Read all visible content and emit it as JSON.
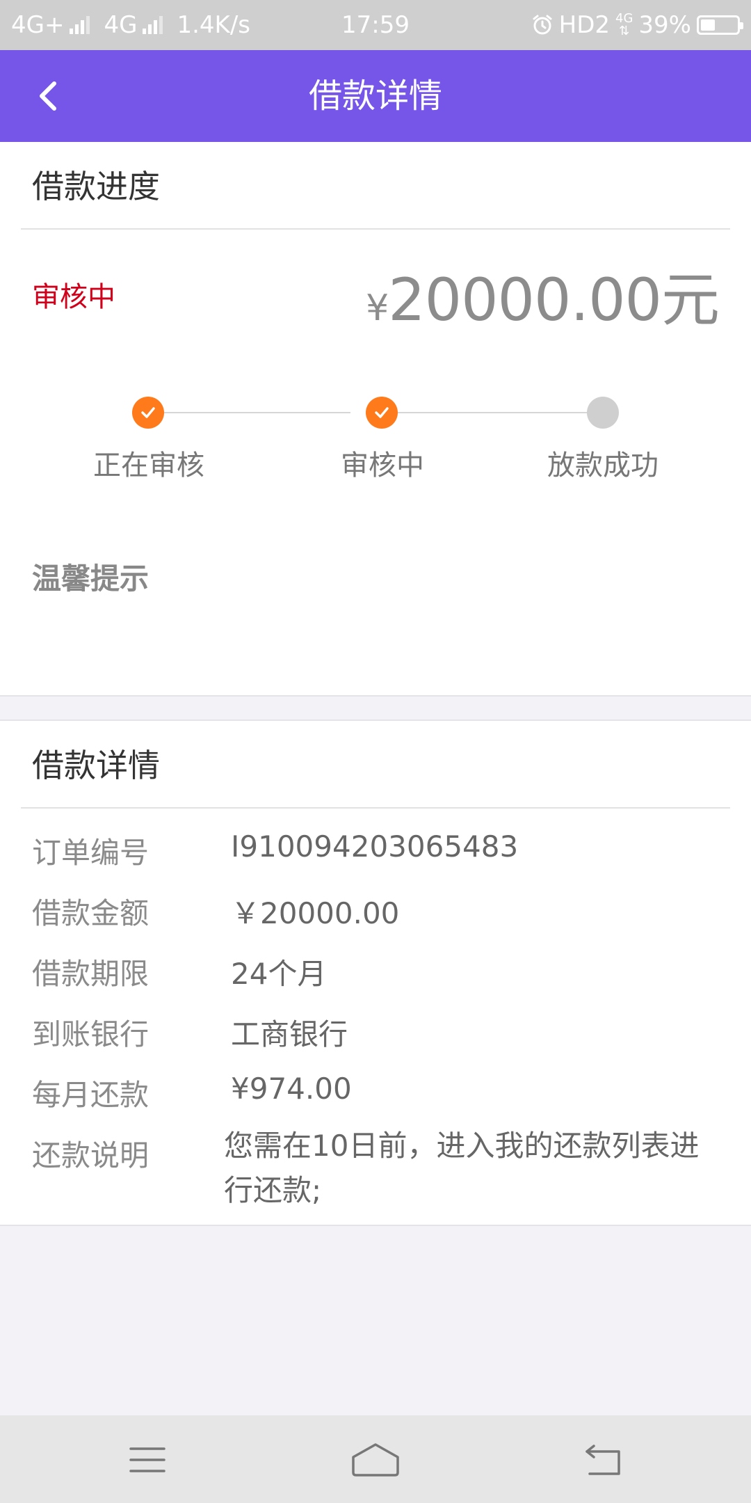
{
  "status_bar": {
    "network1": "4G+",
    "network2": "4G",
    "speed": "1.4K/s",
    "time": "17:59",
    "hd": "HD2",
    "small_net": "4G",
    "battery_text": "39%",
    "battery_level": 0.39
  },
  "header": {
    "title": "借款详情",
    "back_icon": "chevron-left-icon"
  },
  "progress": {
    "section_title": "借款进度",
    "status": "审核中",
    "amount_symbol": "¥",
    "amount_value": "20000.00元",
    "steps": [
      {
        "label": "正在审核",
        "state": "done"
      },
      {
        "label": "审核中",
        "state": "done"
      },
      {
        "label": "放款成功",
        "state": "pending"
      }
    ],
    "tip_title": "温馨提示"
  },
  "details": {
    "section_title": "借款详情",
    "rows": [
      {
        "label": "订单编号",
        "value": "I910094203065483"
      },
      {
        "label": "借款金额",
        "value": "￥20000.00"
      },
      {
        "label": "借款期限",
        "value": "24个月"
      },
      {
        "label": "到账银行",
        "value": "工商银行"
      },
      {
        "label": "每月还款",
        "value": "¥974.00"
      },
      {
        "label": "还款说明",
        "value": "您需在10日前，进入我的还款列表进行还款;"
      }
    ]
  },
  "nav_bar": {
    "menu_icon": "menu-icon",
    "home_icon": "home-icon",
    "back_icon": "back-arrow-icon"
  },
  "colors": {
    "brand": "#7656e8",
    "status_red": "#d0021b",
    "step_done": "#ff7a1a",
    "step_pending": "#cfcfcf"
  }
}
